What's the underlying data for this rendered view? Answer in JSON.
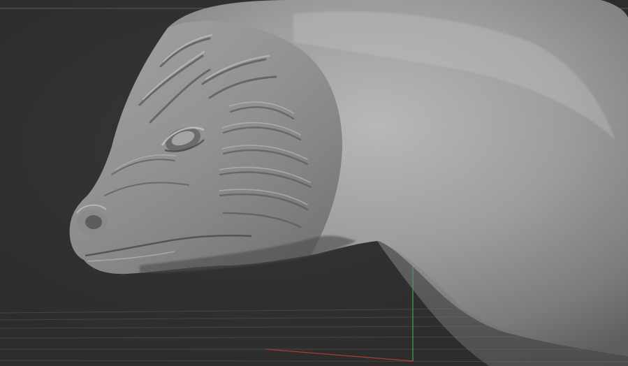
{
  "viewport": {
    "background_color": "#2f2f2f",
    "mesh_color": "#9c9c9c",
    "grid_color": "#4a4a4a",
    "axis_colors": {
      "x": "#b03a3a",
      "y": "#3fa34a"
    }
  }
}
